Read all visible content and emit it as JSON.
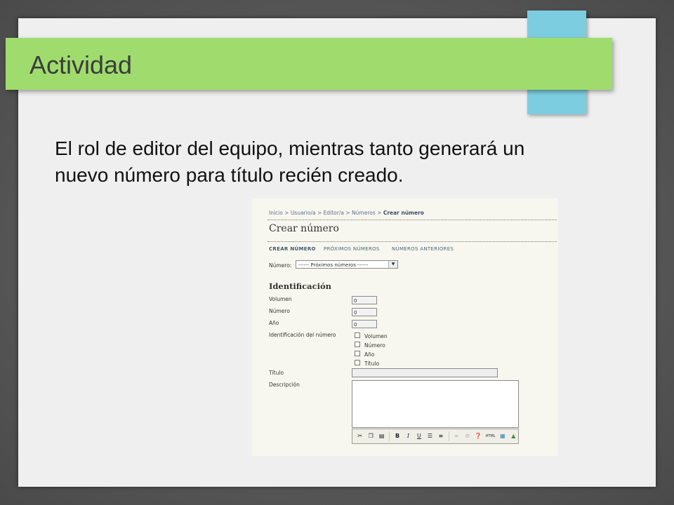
{
  "slide": {
    "title": "Actividad",
    "body": "El rol de editor del equipo, mientras tanto generará un nuevo número para título recién creado."
  },
  "screenshot": {
    "breadcrumb": {
      "items": [
        "Inicio",
        "Usuario/a",
        "Editor/a",
        "Números"
      ],
      "current": "Crear número",
      "separator": ">"
    },
    "page_title": "Crear número",
    "tabs": [
      "CREAR NÚMERO",
      "PRÓXIMOS NÚMEROS",
      "NÚMEROS ANTERIORES"
    ],
    "numero_select": {
      "label": "Número:",
      "value": "------ Próximos números ------"
    },
    "section_title": "Identificación",
    "fields": {
      "volumen": {
        "label": "Volumen",
        "value": "0"
      },
      "numero": {
        "label": "Número",
        "value": "0"
      },
      "anio": {
        "label": "Año",
        "value": "0"
      }
    },
    "identificacion_label": "Identificación del número",
    "checkboxes": [
      "Volumen",
      "Número",
      "Año",
      "Título"
    ],
    "titulo_label": "Título",
    "descripcion_label": "Descripción",
    "toolbar": {
      "buttons": [
        "cut-icon",
        "copy-icon",
        "paste-icon",
        "bold-icon",
        "italic-icon",
        "underline-icon",
        "bullet-list-icon",
        "numbered-list-icon",
        "link-icon",
        "unlink-icon",
        "help-icon",
        "html-icon",
        "fullscreen-icon",
        "image-icon"
      ],
      "bold": "B",
      "italic": "I",
      "underline": "U",
      "html": "HTML"
    }
  },
  "colors": {
    "title_bar": "#9fdc6d",
    "tab_accent": "#7dcde0",
    "slide_bg": "#efefef"
  }
}
